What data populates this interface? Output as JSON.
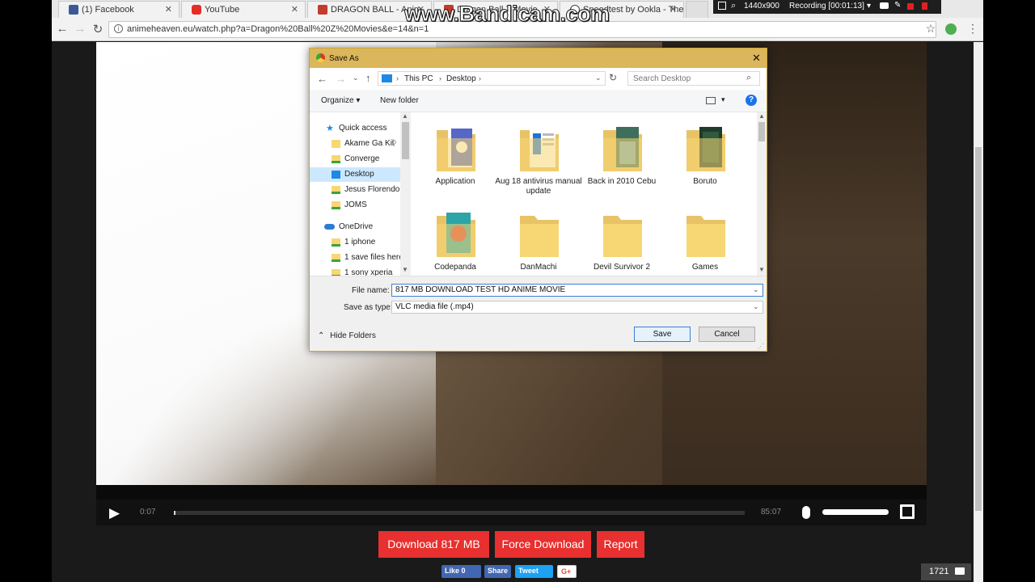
{
  "tabs": [
    {
      "label": "(1) Facebook",
      "favicon": "facebook-icon",
      "color": "#3b5998"
    },
    {
      "label": "YouTube",
      "favicon": "youtube-icon",
      "color": "#e52d27"
    },
    {
      "label": "DRAGON BALL - Anim",
      "favicon": "animeheaven-icon",
      "color": "#c23b2b"
    },
    {
      "label": "Dragon Ball Z Movie",
      "favicon": "animeheaven-icon",
      "color": "#c23b2b"
    },
    {
      "label": "Speedtest by Ookla - The",
      "favicon": "speedtest-icon",
      "color": "#444444"
    }
  ],
  "omnibox": {
    "url": "animeheaven.eu/watch.php?a=Dragon%20Ball%20Z%20Movies&e=14&n=1"
  },
  "bandicam": {
    "watermark": "www.Bandicam.com",
    "resolution": "1440x900",
    "recording": "Recording [00:01:13]"
  },
  "dialog": {
    "title": "Save As",
    "breadcrumb": [
      "This PC",
      "Desktop"
    ],
    "search_placeholder": "Search Desktop",
    "organize": "Organize",
    "new_folder": "New folder",
    "nav": {
      "quick_access": "Quick access",
      "quick_items": [
        "Akame Ga Kil",
        "Converge",
        "Desktop",
        "Jesus Florendo",
        "JOMS"
      ],
      "onedrive": "OneDrive",
      "onedrive_items": [
        "1 iphone",
        "1 save files here",
        "1 sony xperia"
      ]
    },
    "folders": [
      {
        "name": "Application",
        "icon": "folder-discord-icon"
      },
      {
        "name": "Aug 18 antivirus manual update",
        "icon": "folder-document-icon"
      },
      {
        "name": "Back in 2010 Cebu",
        "icon": "folder-photo-icon"
      },
      {
        "name": "Boruto",
        "icon": "folder-photo-icon"
      },
      {
        "name": "Codepanda",
        "icon": "folder-image-icon"
      },
      {
        "name": "DanMachi",
        "icon": "folder-icon"
      },
      {
        "name": "Devil Survivor 2",
        "icon": "folder-icon"
      },
      {
        "name": "Games",
        "icon": "folder-icon"
      }
    ],
    "file_name_label": "File name:",
    "file_name_value": "817 MB DOWNLOAD TEST HD ANIME MOVIE",
    "save_type_label": "Save as type:",
    "save_type_value": "VLC media file (.mp4)",
    "hide_folders": "Hide Folders",
    "save": "Save",
    "cancel": "Cancel"
  },
  "player": {
    "current_time": "0:07",
    "duration": "85:07",
    "progress": 0.001,
    "volume": 1.0
  },
  "buttons": {
    "download": "Download 817 MB",
    "force_download": "Force Download",
    "report": "Report"
  },
  "social": {
    "like": "Like 0",
    "share": "Share",
    "tweet": "Tweet",
    "gplus": "G+"
  },
  "counter": {
    "value": "1721"
  },
  "colors": {
    "dialog_title": "#dcb65a",
    "red_button": "#e7302f",
    "facebook": "#3b5998",
    "twitter": "#1da1f2"
  }
}
